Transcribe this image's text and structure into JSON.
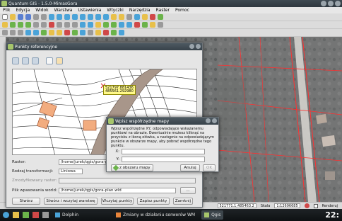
{
  "app": {
    "title": "Quantum GIS - 1.5.0-MimasGora",
    "menu": [
      "Plik",
      "Edycja",
      "Widok",
      "Warstwa",
      "Ustawienia",
      "Wtyczki",
      "Narzędzia",
      "Raster",
      "Pomoc"
    ]
  },
  "georef_dialog": {
    "title": "Punkty referencyjne",
    "coord_label_x": "521797.881436",
    "coord_label_y": "485561.292980",
    "raster_label": "Raster:",
    "raster_value": "/home/jurek/qgis/gora-plan.png",
    "transform_label": "Rodzaj transformacji:",
    "transform_value": "Liniowa",
    "modified_label": "Zmodyfikowany raster:",
    "modified_value": "",
    "world_label": "Plik wpasowania world:",
    "world_value": "/home/jurek/qgis/gora-plan.wld",
    "browse_label": "...",
    "buttons": [
      "Stwórz",
      "Stwórz i wczytaj warstwę",
      "Wczytaj punkty",
      "Zapisz punkty",
      "Zamknij"
    ]
  },
  "coord_dialog": {
    "title": "Wpisz współrzędne mapy",
    "description": "Wpisz współrzędne XY, odpowiadające wskazanemu punktowi na obrazie. Ewentualnie możesz kliknąć na przycisku z ikoną ołówka, a następnie na odpowiadającym punkcie w obszarze mapy, aby pobrać współrzędne tego punktu.",
    "x_label": "X:",
    "y_label": "Y:",
    "x_value": "",
    "y_value": "",
    "from_map_label": "z obszaru mapy",
    "cancel_label": "Anuluj",
    "ok_label": "OK"
  },
  "status": {
    "coords": "521771.1,485463.2",
    "scale_label": "Skala",
    "scale_value": "1:12696685",
    "render_label": "Renderuj"
  },
  "taskbar": {
    "items": [
      "Dolphin",
      "Zmiany w działaniu serwerów WM",
      "Qgis"
    ],
    "clock": "22:"
  },
  "colors": {
    "parcel_fill": "#f2ac7f",
    "parcel_stroke": "#a0522d",
    "road_fill": "#a8968a",
    "road_lines": "#ff3030",
    "coord_box": "#fff98a"
  }
}
